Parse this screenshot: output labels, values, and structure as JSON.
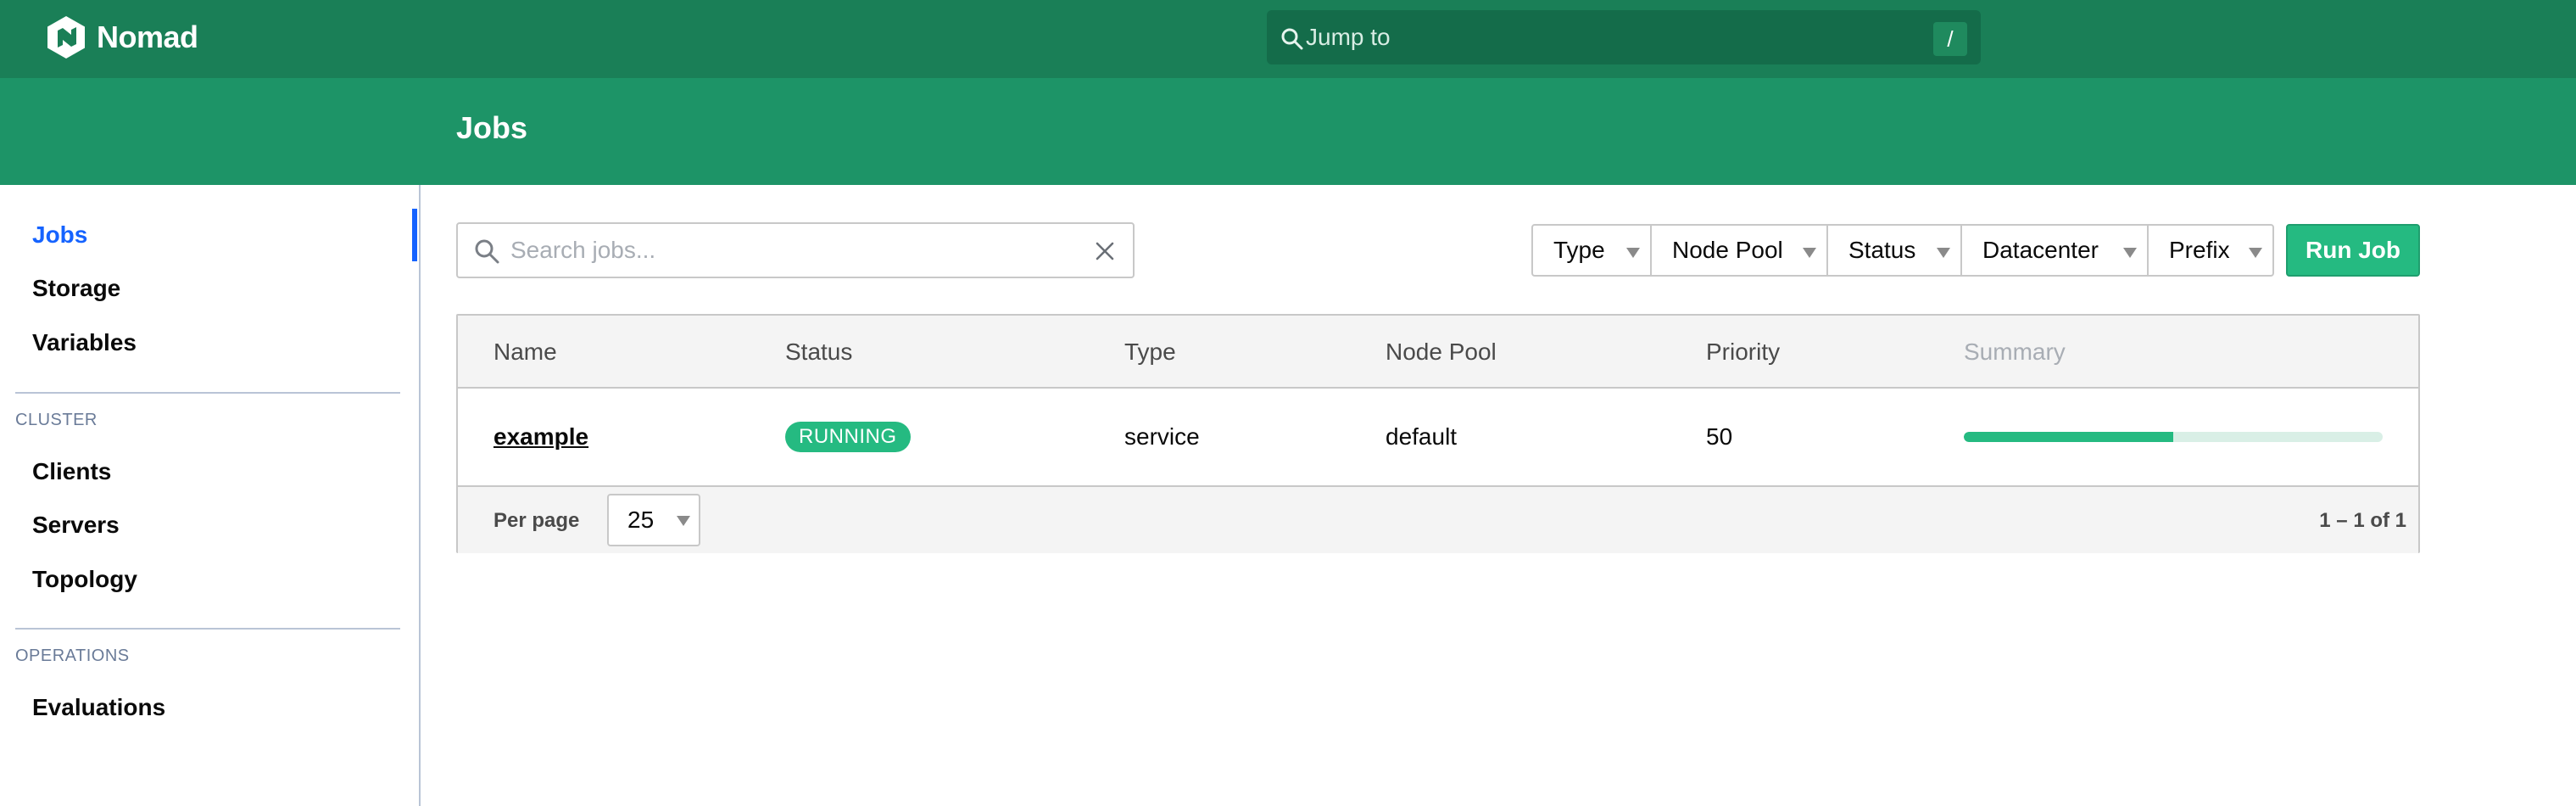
{
  "app": {
    "name": "Nomad"
  },
  "topbar": {
    "jump_text": "Jump to",
    "jump_shortcut": "/"
  },
  "header": {
    "title": "Jobs"
  },
  "sidebar": {
    "items": [
      {
        "label": "Jobs",
        "active": true
      },
      {
        "label": "Storage"
      },
      {
        "label": "Variables"
      }
    ],
    "cluster_heading": "CLUSTER",
    "cluster_items": [
      {
        "label": "Clients"
      },
      {
        "label": "Servers"
      },
      {
        "label": "Topology"
      }
    ],
    "operations_heading": "OPERATIONS",
    "operations_items": [
      {
        "label": "Evaluations"
      }
    ]
  },
  "toolbar": {
    "search_placeholder": "Search jobs...",
    "filters": [
      "Type",
      "Node Pool",
      "Status",
      "Datacenter",
      "Prefix"
    ],
    "run_job_label": "Run Job"
  },
  "table": {
    "columns": [
      "Name",
      "Status",
      "Type",
      "Node Pool",
      "Priority",
      "Summary"
    ],
    "rows": [
      {
        "name": "example",
        "status": "RUNNING",
        "type": "service",
        "node_pool": "default",
        "priority": "50",
        "summary_fraction": 0.5
      }
    ],
    "per_page_label": "Per page",
    "per_page_value": "25",
    "range_text": "1 – 1 of 1"
  },
  "colors": {
    "brand_dark": "#1a7f57",
    "brand": "#1d9467",
    "accent_green": "#25ba81",
    "active_blue": "#1563ff"
  },
  "icons": {
    "logo": "nomad-logo-icon",
    "jump": "search-icon",
    "search": "search-icon",
    "clear": "close-icon",
    "caret": "chevron-down-icon"
  }
}
